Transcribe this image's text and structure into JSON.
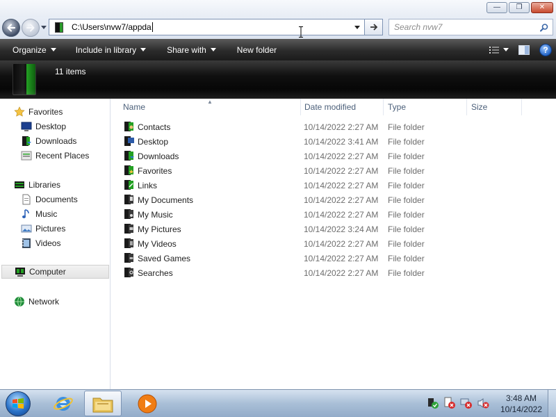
{
  "window": {
    "controls": {
      "minimize": "—",
      "maximize": "❐",
      "close": "✕"
    }
  },
  "address": {
    "path": "C:\\Users\\nvw7/appda",
    "search_placeholder": "Search nvw7"
  },
  "toolbar": {
    "organize": "Organize",
    "include_in_library": "Include in library",
    "share_with": "Share with",
    "new_folder": "New folder"
  },
  "details": {
    "item_count": "11 items"
  },
  "nav": {
    "favorites": "Favorites",
    "desktop": "Desktop",
    "downloads": "Downloads",
    "recent_places": "Recent Places",
    "libraries": "Libraries",
    "documents": "Documents",
    "music": "Music",
    "pictures": "Pictures",
    "videos": "Videos",
    "computer": "Computer",
    "network": "Network"
  },
  "columns": {
    "name": "Name",
    "date_modified": "Date modified",
    "type": "Type",
    "size": "Size"
  },
  "files": [
    {
      "name": "Contacts",
      "date": "10/14/2022 2:27 AM",
      "type": "File folder"
    },
    {
      "name": "Desktop",
      "date": "10/14/2022 3:41 AM",
      "type": "File folder"
    },
    {
      "name": "Downloads",
      "date": "10/14/2022 2:27 AM",
      "type": "File folder"
    },
    {
      "name": "Favorites",
      "date": "10/14/2022 2:27 AM",
      "type": "File folder"
    },
    {
      "name": "Links",
      "date": "10/14/2022 2:27 AM",
      "type": "File folder"
    },
    {
      "name": "My Documents",
      "date": "10/14/2022 2:27 AM",
      "type": "File folder"
    },
    {
      "name": "My Music",
      "date": "10/14/2022 2:27 AM",
      "type": "File folder"
    },
    {
      "name": "My Pictures",
      "date": "10/14/2022 3:24 AM",
      "type": "File folder"
    },
    {
      "name": "My Videos",
      "date": "10/14/2022 2:27 AM",
      "type": "File folder"
    },
    {
      "name": "Saved Games",
      "date": "10/14/2022 2:27 AM",
      "type": "File folder"
    },
    {
      "name": "Searches",
      "date": "10/14/2022 2:27 AM",
      "type": "File folder"
    }
  ],
  "taskbar": {
    "time": "3:48 AM",
    "date": "10/14/2022"
  },
  "colors": {
    "accent_green": "#23a023",
    "toolbar_dark": "#2b2b2b",
    "header_text": "#4c607a",
    "secondary_text": "#6d6d6d"
  }
}
